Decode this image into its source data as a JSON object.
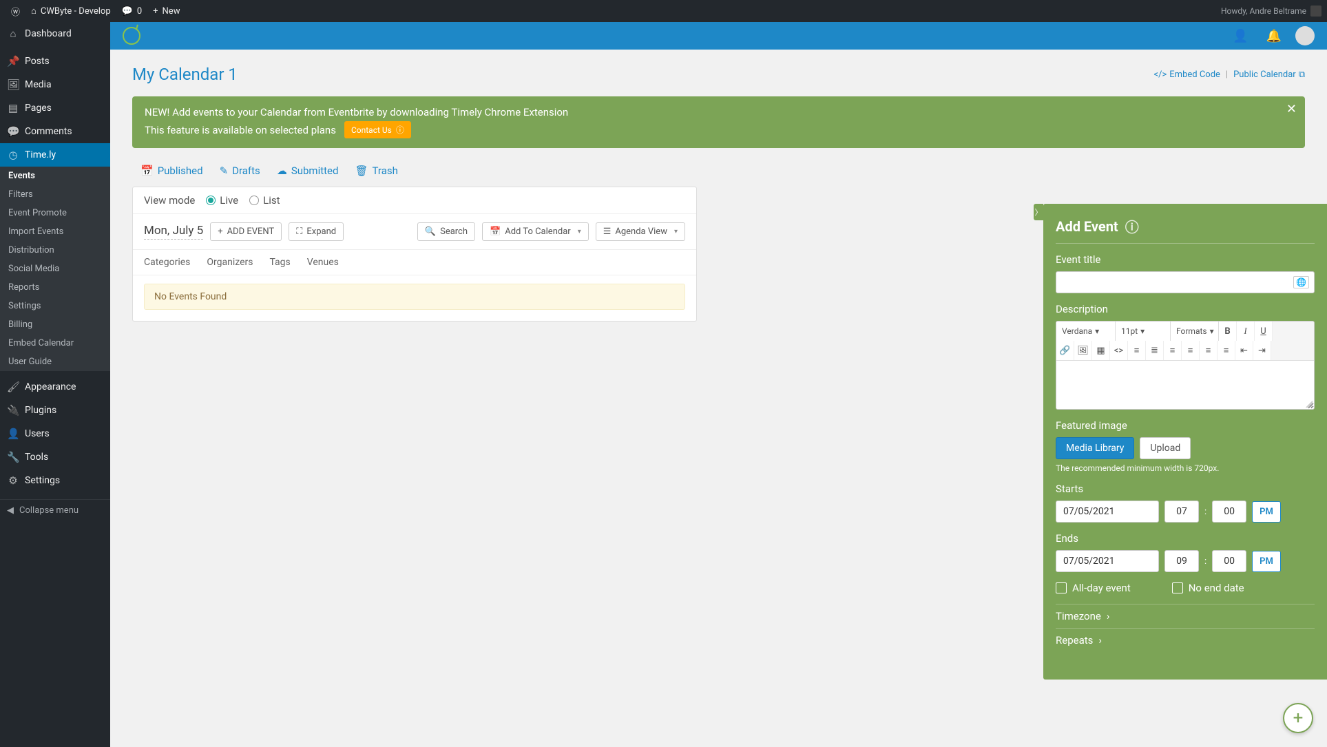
{
  "adminbar": {
    "site": "CWByte - Develop",
    "comments": "0",
    "new": "New",
    "greeting": "Howdy, Andre Beltrame"
  },
  "wp_sidebar": {
    "items": [
      {
        "label": "Dashboard",
        "icon": "⌂"
      },
      {
        "label": "Posts",
        "icon": "📌"
      },
      {
        "label": "Media",
        "icon": "🖼"
      },
      {
        "label": "Pages",
        "icon": "▤"
      },
      {
        "label": "Comments",
        "icon": "💬"
      },
      {
        "label": "Time.ly",
        "icon": "◷",
        "active": true
      },
      {
        "label": "Appearance",
        "icon": "🖌"
      },
      {
        "label": "Plugins",
        "icon": "🔌"
      },
      {
        "label": "Users",
        "icon": "👤"
      },
      {
        "label": "Tools",
        "icon": "🔧"
      },
      {
        "label": "Settings",
        "icon": "⚙"
      }
    ],
    "timely_sub": [
      "Events",
      "Filters",
      "Event Promote",
      "Import Events",
      "Distribution",
      "Social Media",
      "Reports",
      "Settings",
      "Billing",
      "Embed Calendar",
      "User Guide"
    ],
    "collapse": "Collapse menu"
  },
  "page_title": "My Calendar 1",
  "title_links": {
    "embed": "Embed Code",
    "public": "Public Calendar"
  },
  "notice": {
    "line1": "NEW! Add events to your Calendar from Eventbrite by downloading Timely Chrome Extension",
    "line2": "This feature is available on selected plans",
    "contact": "Contact Us"
  },
  "status_tabs": {
    "published": "Published",
    "drafts": "Drafts",
    "submitted": "Submitted",
    "trash": "Trash"
  },
  "viewmode": {
    "label": "View mode",
    "live": "Live",
    "list": "List"
  },
  "toolbar": {
    "date": "Mon, July 5",
    "add_event": "ADD EVENT",
    "expand": "Expand",
    "search": "Search",
    "add_to_cal": "Add To Calendar",
    "agenda": "Agenda View"
  },
  "filter_tabs": [
    "Categories",
    "Organizers",
    "Tags",
    "Venues"
  ],
  "no_events": "No Events Found",
  "panel": {
    "title": "Add Event",
    "event_title_label": "Event title",
    "description_label": "Description",
    "editor": {
      "font": "Verdana",
      "size": "11pt",
      "formats": "Formats"
    },
    "featured_label": "Featured image",
    "media_library": "Media Library",
    "upload": "Upload",
    "hint": "The recommended minimum width is 720px.",
    "starts_label": "Starts",
    "ends_label": "Ends",
    "start": {
      "date": "07/05/2021",
      "h": "07",
      "m": "00",
      "ampm": "PM"
    },
    "end": {
      "date": "07/05/2021",
      "h": "09",
      "m": "00",
      "ampm": "PM"
    },
    "allday": "All-day event",
    "noend": "No end date",
    "timezone": "Timezone",
    "repeats": "Repeats"
  }
}
